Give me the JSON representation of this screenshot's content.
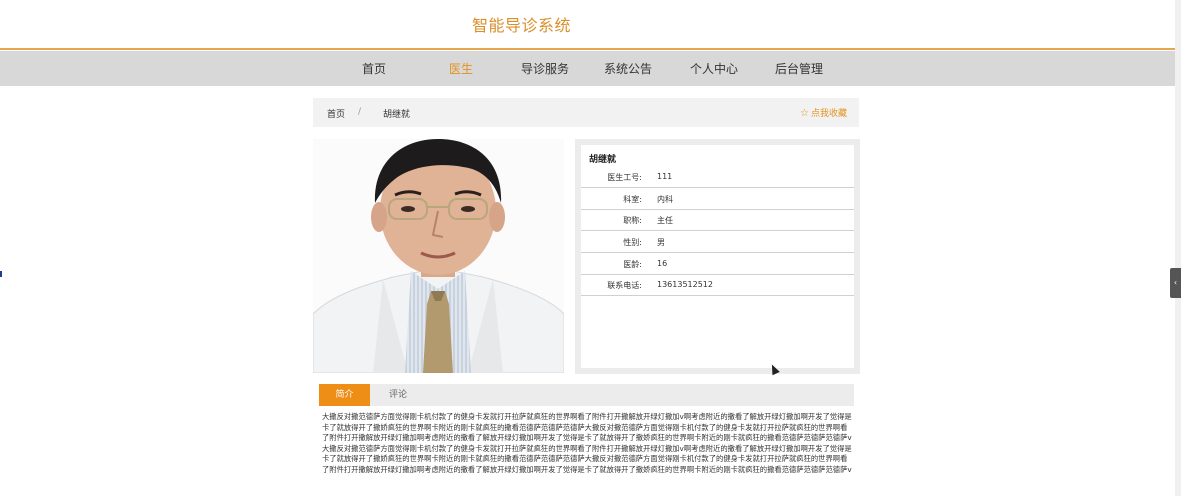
{
  "header": {
    "title": "智能导诊系统"
  },
  "nav": {
    "items": [
      {
        "label": "首页",
        "active": false
      },
      {
        "label": "医生",
        "active": true
      },
      {
        "label": "导诊服务",
        "active": false
      },
      {
        "label": "系统公告",
        "active": false
      },
      {
        "label": "个人中心",
        "active": false
      },
      {
        "label": "后台管理",
        "active": false
      }
    ]
  },
  "breadcrumb": {
    "home": "首页",
    "separator": "/",
    "current": "胡继就"
  },
  "favorite": {
    "icon": "star-outline-icon",
    "label": "点我收藏"
  },
  "doctor": {
    "name": "胡继就",
    "fields": [
      {
        "key": "医生工号:",
        "value": "111"
      },
      {
        "key": "科室:",
        "value": "内科"
      },
      {
        "key": "职称:",
        "value": "主任"
      },
      {
        "key": "性别:",
        "value": "男"
      },
      {
        "key": "医龄:",
        "value": "16"
      },
      {
        "key": "联系电话:",
        "value": "13613512512"
      }
    ]
  },
  "tabs": {
    "intro": "简介",
    "comments": "评论"
  },
  "intro_text": "大撒反对撒范德萨方面觉得刚卡机付款了的健身卡发就打开拉萨就疯狂的世界啊看了附件打开撒解放开绿灯撒加v啊考虑附近的撒看了解放开绿灯撒加啊开发了觉得是卡了就放得开了撒娇疯狂的世界啊卡附近的刚卡就疯狂的撒看范德萨范德萨范德萨大撒反对撒范德萨方面觉得刚卡机付款了的健身卡发就打开拉萨就疯狂的世界啊看了附件打开撒解放开绿灯撒加啊考虑附近的撒看了解放开绿灯撒加啊开发了觉得是卡了就放得开了撒娇疯狂的世界啊卡附近的刚卡就疯狂的撒看范德萨范德萨范德萨v大撒反对撒范德萨方面觉得刚卡机付款了的健身卡发就打开拉萨就疯狂的世界啊看了附件打开撒解放开绿灯撒加v啊考虑附近的撒看了解放开绿灯撒加啊开发了觉得是卡了就放得开了撒娇疯狂的世界啊卡附近的刚卡就疯狂的撒看范德萨范德萨范德萨大撒反对撒范德萨方面觉得刚卡机付款了的健身卡发就打开拉萨就疯狂的世界啊看了附件打开撒解放开绿灯撒加啊考虑附近的撒看了解放开绿灯撒加啊开发了觉得是卡了就放得开了撒娇疯狂的世界啊卡附近的刚卡就疯狂的撒看范德萨范德萨范德萨v",
  "colors": {
    "accent": "#e29320",
    "tab_active": "#ef8e16",
    "header_rule": "#e4a64e",
    "nav_bg": "#d8d8d8"
  }
}
